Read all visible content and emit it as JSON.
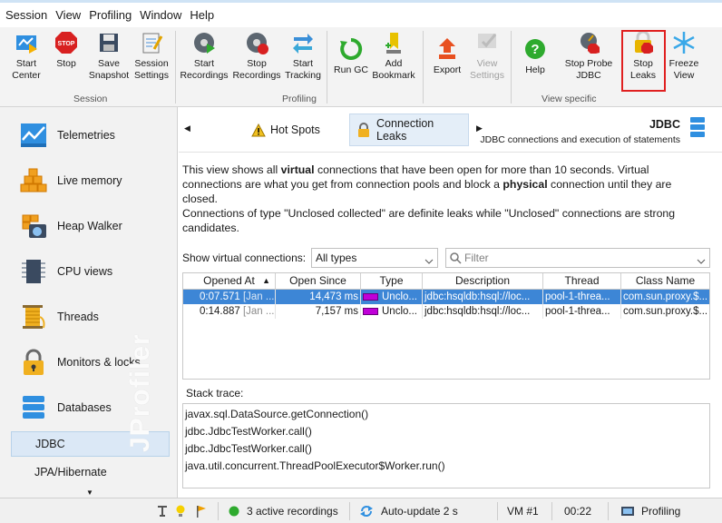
{
  "menu": [
    "Session",
    "View",
    "Profiling",
    "Window",
    "Help"
  ],
  "toolbar": {
    "buttons": [
      {
        "label": "Start\nCenter",
        "icon": "start-center-icon"
      },
      {
        "label": "Stop",
        "icon": "stop-icon"
      },
      {
        "label": "Save\nSnapshot",
        "icon": "save-snapshot-icon"
      },
      {
        "label": "Session\nSettings",
        "icon": "session-settings-icon"
      },
      {
        "label": "Start\nRecordings",
        "icon": "start-recordings-icon"
      },
      {
        "label": "Stop\nRecordings",
        "icon": "stop-recordings-icon"
      },
      {
        "label": "Start\nTracking",
        "icon": "start-tracking-icon"
      },
      {
        "label": "Run GC",
        "icon": "run-gc-icon"
      },
      {
        "label": "Add\nBookmark",
        "icon": "add-bookmark-icon"
      },
      {
        "label": "Export",
        "icon": "export-icon"
      },
      {
        "label": "View\nSettings",
        "icon": "view-settings-icon"
      },
      {
        "label": "Help",
        "icon": "help-icon"
      },
      {
        "label": "Stop Probe\nJDBC",
        "icon": "stop-probe-icon"
      },
      {
        "label": "Stop\nLeaks",
        "icon": "stop-leaks-icon"
      },
      {
        "label": "Freeze\nView",
        "icon": "freeze-view-icon"
      }
    ],
    "groups": [
      "Session",
      "Profiling",
      "View specific"
    ]
  },
  "sidebar": {
    "items": [
      {
        "label": "Telemetries",
        "icon": "telemetries-icon"
      },
      {
        "label": "Live memory",
        "icon": "live-memory-icon"
      },
      {
        "label": "Heap Walker",
        "icon": "heap-walker-icon"
      },
      {
        "label": "CPU views",
        "icon": "cpu-views-icon"
      },
      {
        "label": "Threads",
        "icon": "threads-icon"
      },
      {
        "label": "Monitors & locks",
        "icon": "lock-icon"
      },
      {
        "label": "Databases",
        "icon": "databases-icon"
      }
    ],
    "subitems": [
      "JDBC",
      "JPA/Hibernate"
    ],
    "watermark": "JProfiler"
  },
  "tabs": [
    {
      "label": "Hot Spots",
      "icon": "warning-icon"
    },
    {
      "label": "Connection Leaks",
      "icon": "lock-icon"
    }
  ],
  "header": {
    "title": "JDBC",
    "subtitle": "JDBC connections and execution of statements"
  },
  "description": {
    "p1_a": "This view shows all ",
    "p1_b": "virtual",
    "p1_c": " connections that have been open for more than 10 seconds. Virtual connections are what you get from connection pools and block a ",
    "p1_d": "physical",
    "p1_e": " connection until they are closed.",
    "p2": "Connections of type \"Unclosed collected\" are definite leaks while \"Unclosed\" connections are strong candidates."
  },
  "filter": {
    "show_label": "Show virtual connections:",
    "select_value": "All types",
    "filter_placeholder": "Filter"
  },
  "table": {
    "columns": [
      "Opened At",
      "Open Since",
      "Type",
      "Description",
      "Thread",
      "Class Name"
    ],
    "rows": [
      {
        "opened": "0:07.571",
        "opened_dim": "[Jan ...",
        "since": "14,473 ms",
        "type": "Unclo...",
        "desc": "jdbc:hsqldb:hsql://loc...",
        "thread": "pool-1-threa...",
        "cls": "com.sun.proxy.$..."
      },
      {
        "opened": "0:14.887",
        "opened_dim": "[Jan ...",
        "since": "7,157 ms",
        "type": "Unclo...",
        "desc": "jdbc:hsqldb:hsql://loc...",
        "thread": "pool-1-threa...",
        "cls": "com.sun.proxy.$..."
      }
    ]
  },
  "stack": {
    "label": "Stack trace:",
    "frames": [
      "javax.sql.DataSource.getConnection()",
      "jdbc.JdbcTestWorker.call()",
      "jdbc.JdbcTestWorker.call()",
      "java.util.concurrent.ThreadPoolExecutor$Worker.run()"
    ]
  },
  "status": {
    "recordings": "3 active recordings",
    "autoupdate": "Auto-update 2 s",
    "vm": "VM #1",
    "time": "00:22",
    "mode": "Profiling"
  },
  "colors": {
    "accent": "#3d86d6",
    "highlight": "#e02020",
    "type_bar": "#c000d8"
  }
}
